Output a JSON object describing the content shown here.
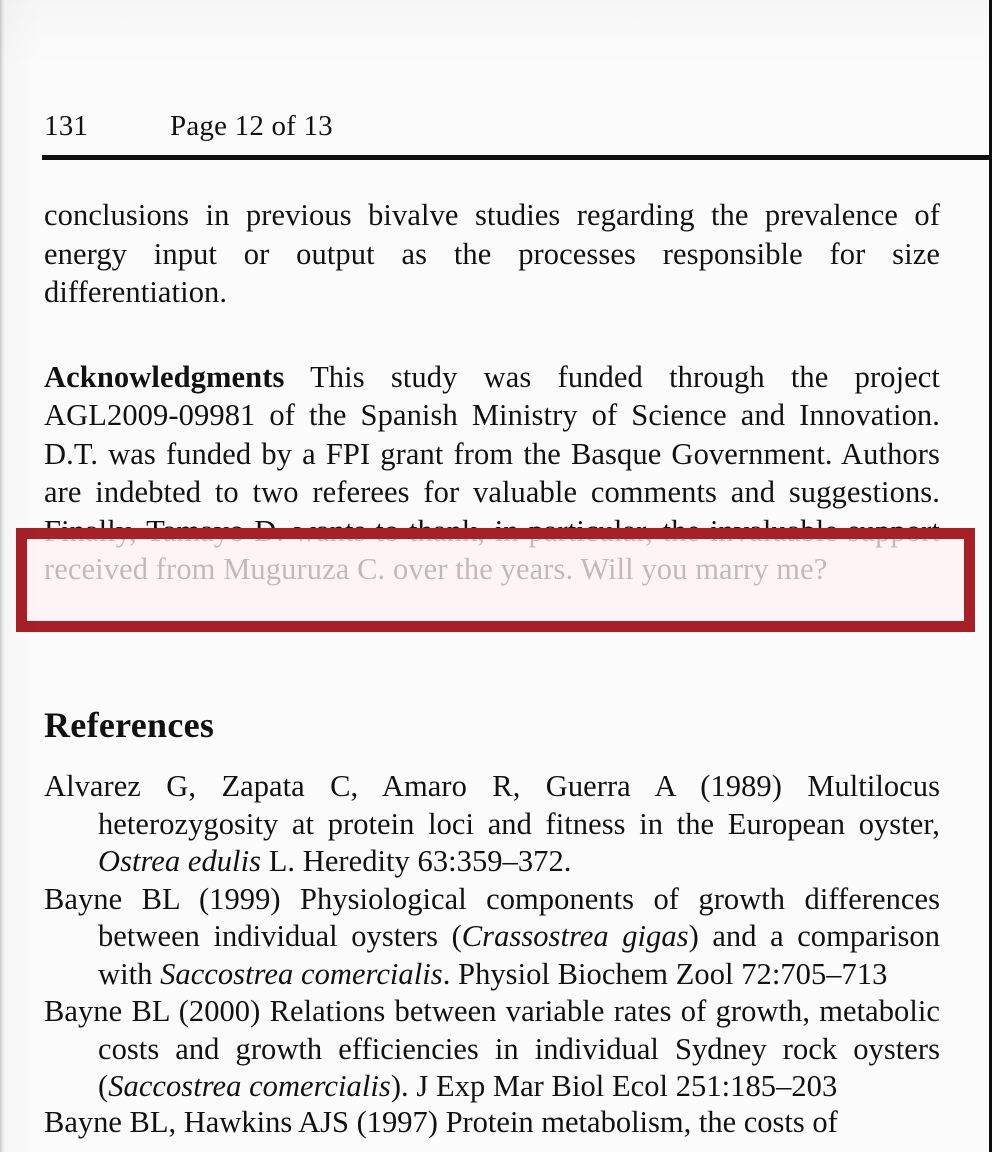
{
  "running_head": {
    "folio": "131",
    "page_of": "Page 12 of 13"
  },
  "body": {
    "conclusions_paragraph": "conclusions in previous bivalve studies regarding the prevalence of energy input or output as the processes responsible for size differentiation.",
    "acknowledgments_label": "Acknowledgments",
    "acknowledgments_text": " This study was funded through the project AGL2009-09981 of the Spanish Ministry of Science and Innovation. D.T. was funded by a FPI grant from the Basque Government. Authors are indebted to two referees for valuable comments and suggestions. Finally, Tamayo D. wants to thank, in particular, the invaluable support received from Muguruza C. over the years. Will you marry me?"
  },
  "highlight": {
    "color": "#a81f26",
    "highlighted_text": "tions. Finally, Tamayo D. wants to thank, in particular, the invaluable support received from Muguruza C. over the years. Will you marry me?"
  },
  "references": {
    "heading": "References",
    "entries": [
      {
        "pre": "Alvarez G, Zapata C, Amaro R, Guerra A (1989) Multilocus heterozygosity at protein loci and fitness in the European oyster, ",
        "italic_1": "Ostrea edulis",
        "mid": " L. Heredity 63:359–372.",
        "italic_2": "",
        "post": ""
      },
      {
        "pre": "Bayne BL (1999) Physiological components of growth differences between individual oysters (",
        "italic_1": "Crassostrea gigas",
        "mid": ") and a comparison with ",
        "italic_2": "Saccostrea comercialis",
        "post": ". Physiol Biochem Zool 72:705–713"
      },
      {
        "pre": "Bayne BL (2000) Relations between variable rates of growth, metabolic costs and growth efficiencies in individual Sydney rock oysters (",
        "italic_1": "Saccostrea comercialis",
        "mid": "). J Exp Mar Biol Ecol 251:185–203",
        "italic_2": "",
        "post": ""
      }
    ],
    "clipped_entry": "Bayne BL, Hawkins AJS (1997) Protein metabolism, the costs of"
  }
}
